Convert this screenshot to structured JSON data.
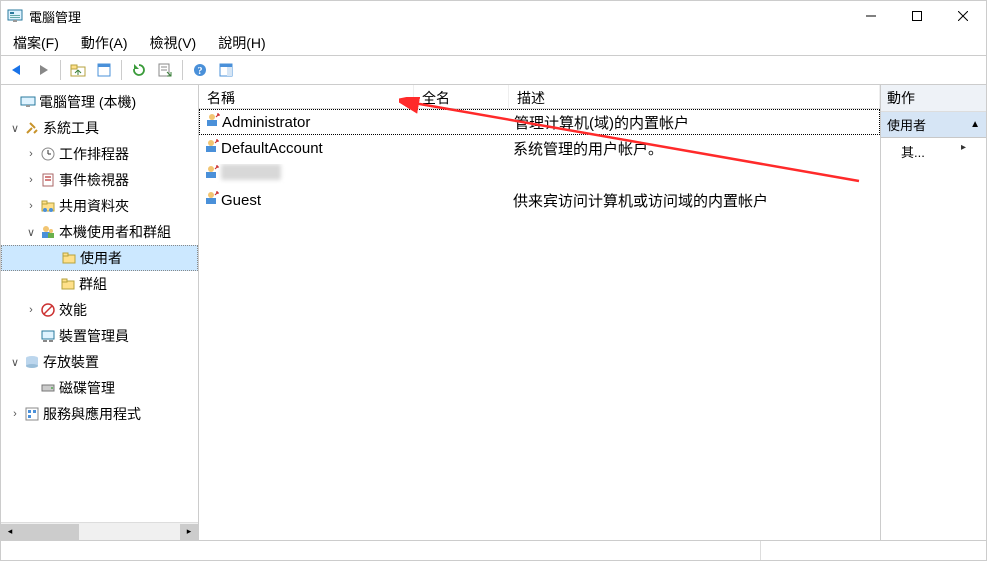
{
  "title": "電腦管理",
  "menu": {
    "file": "檔案(F)",
    "action": "動作(A)",
    "view": "檢視(V)",
    "help": "說明(H)"
  },
  "tree": {
    "root": "電腦管理 (本機)",
    "sysTools": "系統工具",
    "taskScheduler": "工作排程器",
    "eventViewer": "事件檢視器",
    "sharedFolders": "共用資料夾",
    "localUsersGroups": "本機使用者和群組",
    "users": "使用者",
    "groups": "群組",
    "performance": "效能",
    "deviceManager": "裝置管理員",
    "storage": "存放裝置",
    "diskManagement": "磁碟管理",
    "services": "服務與應用程式"
  },
  "listHeader": {
    "name": "名稱",
    "fullName": "全名",
    "description": "描述"
  },
  "users": [
    {
      "name": "Administrator",
      "full": "",
      "desc": "管理计算机(域)的内置帐户",
      "focused": true
    },
    {
      "name": "DefaultAccount",
      "full": "",
      "desc": "系统管理的用户帐户。",
      "focused": false
    },
    {
      "name": "",
      "full": "",
      "desc": "",
      "focused": false,
      "blurred": true
    },
    {
      "name": "Guest",
      "full": "",
      "desc": "供来宾访问计算机或访问域的内置帐户",
      "focused": false
    }
  ],
  "actionsPanel": {
    "header": "動作",
    "section": "使用者",
    "more": "其...",
    "sectionArrow": "▲",
    "moreArrow": "▸"
  }
}
